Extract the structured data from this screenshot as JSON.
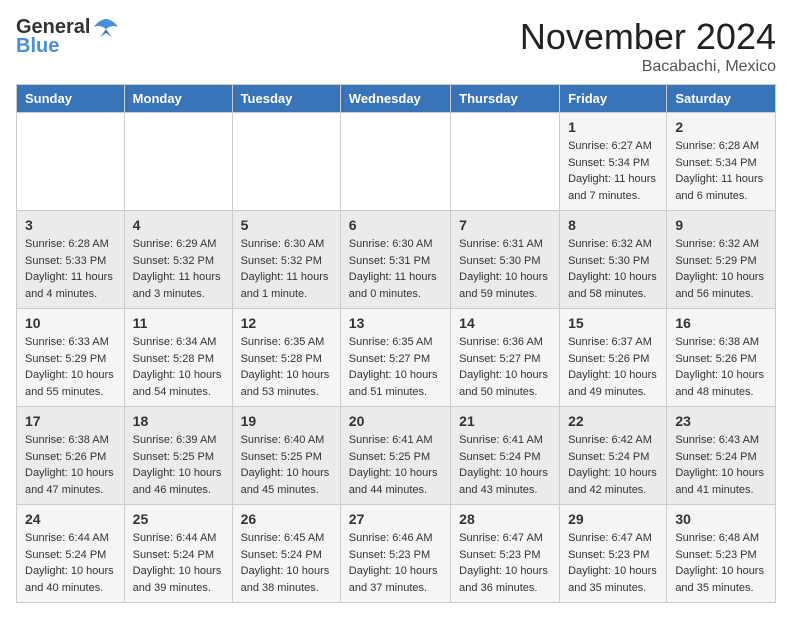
{
  "logo": {
    "general": "General",
    "blue": "Blue"
  },
  "header": {
    "month": "November 2024",
    "location": "Bacabachi, Mexico"
  },
  "days_of_week": [
    "Sunday",
    "Monday",
    "Tuesday",
    "Wednesday",
    "Thursday",
    "Friday",
    "Saturday"
  ],
  "weeks": [
    [
      {
        "day": "",
        "content": ""
      },
      {
        "day": "",
        "content": ""
      },
      {
        "day": "",
        "content": ""
      },
      {
        "day": "",
        "content": ""
      },
      {
        "day": "",
        "content": ""
      },
      {
        "day": "1",
        "content": "Sunrise: 6:27 AM\nSunset: 5:34 PM\nDaylight: 11 hours and 7 minutes."
      },
      {
        "day": "2",
        "content": "Sunrise: 6:28 AM\nSunset: 5:34 PM\nDaylight: 11 hours and 6 minutes."
      }
    ],
    [
      {
        "day": "3",
        "content": "Sunrise: 6:28 AM\nSunset: 5:33 PM\nDaylight: 11 hours and 4 minutes."
      },
      {
        "day": "4",
        "content": "Sunrise: 6:29 AM\nSunset: 5:32 PM\nDaylight: 11 hours and 3 minutes."
      },
      {
        "day": "5",
        "content": "Sunrise: 6:30 AM\nSunset: 5:32 PM\nDaylight: 11 hours and 1 minute."
      },
      {
        "day": "6",
        "content": "Sunrise: 6:30 AM\nSunset: 5:31 PM\nDaylight: 11 hours and 0 minutes."
      },
      {
        "day": "7",
        "content": "Sunrise: 6:31 AM\nSunset: 5:30 PM\nDaylight: 10 hours and 59 minutes."
      },
      {
        "day": "8",
        "content": "Sunrise: 6:32 AM\nSunset: 5:30 PM\nDaylight: 10 hours and 58 minutes."
      },
      {
        "day": "9",
        "content": "Sunrise: 6:32 AM\nSunset: 5:29 PM\nDaylight: 10 hours and 56 minutes."
      }
    ],
    [
      {
        "day": "10",
        "content": "Sunrise: 6:33 AM\nSunset: 5:29 PM\nDaylight: 10 hours and 55 minutes."
      },
      {
        "day": "11",
        "content": "Sunrise: 6:34 AM\nSunset: 5:28 PM\nDaylight: 10 hours and 54 minutes."
      },
      {
        "day": "12",
        "content": "Sunrise: 6:35 AM\nSunset: 5:28 PM\nDaylight: 10 hours and 53 minutes."
      },
      {
        "day": "13",
        "content": "Sunrise: 6:35 AM\nSunset: 5:27 PM\nDaylight: 10 hours and 51 minutes."
      },
      {
        "day": "14",
        "content": "Sunrise: 6:36 AM\nSunset: 5:27 PM\nDaylight: 10 hours and 50 minutes."
      },
      {
        "day": "15",
        "content": "Sunrise: 6:37 AM\nSunset: 5:26 PM\nDaylight: 10 hours and 49 minutes."
      },
      {
        "day": "16",
        "content": "Sunrise: 6:38 AM\nSunset: 5:26 PM\nDaylight: 10 hours and 48 minutes."
      }
    ],
    [
      {
        "day": "17",
        "content": "Sunrise: 6:38 AM\nSunset: 5:26 PM\nDaylight: 10 hours and 47 minutes."
      },
      {
        "day": "18",
        "content": "Sunrise: 6:39 AM\nSunset: 5:25 PM\nDaylight: 10 hours and 46 minutes."
      },
      {
        "day": "19",
        "content": "Sunrise: 6:40 AM\nSunset: 5:25 PM\nDaylight: 10 hours and 45 minutes."
      },
      {
        "day": "20",
        "content": "Sunrise: 6:41 AM\nSunset: 5:25 PM\nDaylight: 10 hours and 44 minutes."
      },
      {
        "day": "21",
        "content": "Sunrise: 6:41 AM\nSunset: 5:24 PM\nDaylight: 10 hours and 43 minutes."
      },
      {
        "day": "22",
        "content": "Sunrise: 6:42 AM\nSunset: 5:24 PM\nDaylight: 10 hours and 42 minutes."
      },
      {
        "day": "23",
        "content": "Sunrise: 6:43 AM\nSunset: 5:24 PM\nDaylight: 10 hours and 41 minutes."
      }
    ],
    [
      {
        "day": "24",
        "content": "Sunrise: 6:44 AM\nSunset: 5:24 PM\nDaylight: 10 hours and 40 minutes."
      },
      {
        "day": "25",
        "content": "Sunrise: 6:44 AM\nSunset: 5:24 PM\nDaylight: 10 hours and 39 minutes."
      },
      {
        "day": "26",
        "content": "Sunrise: 6:45 AM\nSunset: 5:24 PM\nDaylight: 10 hours and 38 minutes."
      },
      {
        "day": "27",
        "content": "Sunrise: 6:46 AM\nSunset: 5:23 PM\nDaylight: 10 hours and 37 minutes."
      },
      {
        "day": "28",
        "content": "Sunrise: 6:47 AM\nSunset: 5:23 PM\nDaylight: 10 hours and 36 minutes."
      },
      {
        "day": "29",
        "content": "Sunrise: 6:47 AM\nSunset: 5:23 PM\nDaylight: 10 hours and 35 minutes."
      },
      {
        "day": "30",
        "content": "Sunrise: 6:48 AM\nSunset: 5:23 PM\nDaylight: 10 hours and 35 minutes."
      }
    ]
  ]
}
